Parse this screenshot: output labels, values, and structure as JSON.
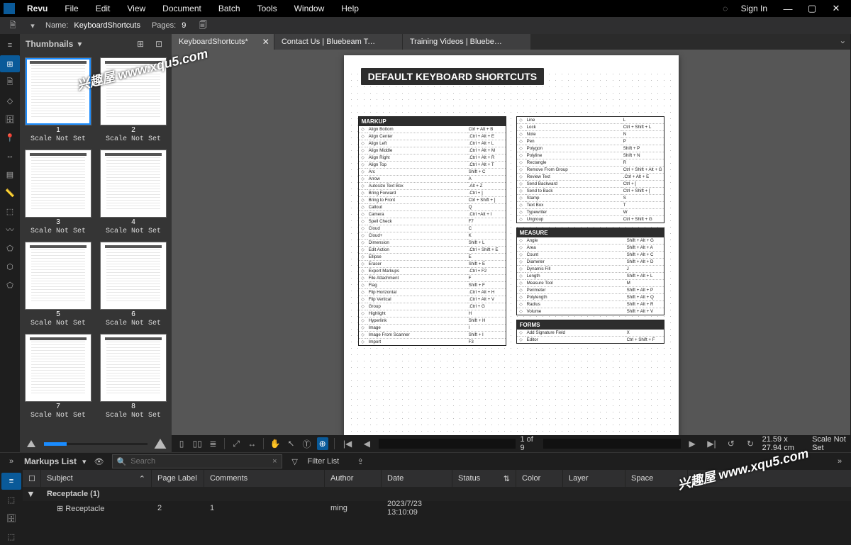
{
  "app": {
    "name": "Revu",
    "signin": "Sign In"
  },
  "menubar": [
    "File",
    "Edit",
    "View",
    "Document",
    "Batch",
    "Tools",
    "Window",
    "Help"
  ],
  "info": {
    "nameLabel": "Name:",
    "docName": "KeyboardShortcuts",
    "pagesLabel": "Pages:",
    "pagesVal": "9"
  },
  "thumbs": {
    "title": "Thumbnails",
    "items": [
      {
        "n": "1",
        "label": "Scale Not Set",
        "selected": true
      },
      {
        "n": "2",
        "label": "Scale Not Set"
      },
      {
        "n": "3",
        "label": "Scale Not Set"
      },
      {
        "n": "4",
        "label": "Scale Not Set"
      },
      {
        "n": "5",
        "label": "Scale Not Set"
      },
      {
        "n": "6",
        "label": "Scale Not Set"
      },
      {
        "n": "7",
        "label": "Scale Not Set"
      },
      {
        "n": "8",
        "label": "Scale Not Set"
      }
    ]
  },
  "tabs": [
    {
      "label": "KeyboardShortcuts*",
      "active": true,
      "closable": true
    },
    {
      "label": "Contact Us | Bluebeam Tec...",
      "active": false
    },
    {
      "label": "Training Videos | Bluebeam...",
      "active": false
    }
  ],
  "page": {
    "title": "DEFAULT KEYBOARD SHORTCUTS",
    "markup": [
      [
        "Align Bottom",
        "Ctrl + Alt + B"
      ],
      [
        "Align Center",
        ".Ctrl + Alt + E"
      ],
      [
        "Align Left",
        ".Ctrl + Alt + L"
      ],
      [
        "Align Middle",
        ".Ctrl + Alt + M"
      ],
      [
        "Align Right",
        ".Ctrl + Alt + R"
      ],
      [
        "Align Top",
        ".Ctrl + Alt + T"
      ],
      [
        "Arc",
        "Shift + C"
      ],
      [
        "Arrow",
        "A"
      ],
      [
        "Autosize Text Box",
        ".Alt + Z"
      ],
      [
        "Bring Forward",
        ".Ctrl + ]"
      ],
      [
        "Bring to Front",
        "Ctrl + Shift + ]"
      ],
      [
        "Callout",
        "Q"
      ],
      [
        "Camera",
        ".Ctrl +Alt + I"
      ],
      [
        "Spell Check",
        "F7"
      ],
      [
        "Cloud",
        "C"
      ],
      [
        "Cloud+",
        "K"
      ],
      [
        "Dimension",
        "Shift + L"
      ],
      [
        "Edit Action",
        ".Ctrl + Shift + E"
      ],
      [
        "Ellipse",
        "E"
      ],
      [
        "Eraser",
        "Shift + E"
      ],
      [
        "Export Markups",
        ".Ctrl + F2"
      ],
      [
        "File Attachment",
        "F"
      ],
      [
        "Flag",
        "Shift + F"
      ],
      [
        "Flip Horizontal",
        ".Ctrl + Alt + H"
      ],
      [
        "Flip Vertical",
        ".Ctrl + Alt + V"
      ],
      [
        "Group",
        ".Ctrl + G"
      ],
      [
        "Highlight",
        "H"
      ],
      [
        "Hyperlink",
        "Shift + H"
      ],
      [
        "Image",
        "I"
      ],
      [
        "Image From Scanner",
        "Shift + I"
      ],
      [
        "Import",
        "F3"
      ]
    ],
    "markup2": [
      [
        "Line",
        "L"
      ],
      [
        "Lock",
        "Ctrl + Shift + L"
      ],
      [
        "Note",
        "N"
      ],
      [
        "Pen",
        "P"
      ],
      [
        "Polygon",
        "Shift + P"
      ],
      [
        "Polyline",
        "Shift + N"
      ],
      [
        "Rectangle",
        "R"
      ],
      [
        "Remove From Group",
        "Ctrl + Shift + Alt + G"
      ],
      [
        "Review Text",
        ".Ctrl + Alt + E"
      ],
      [
        "Send Backward",
        "Ctrl + ["
      ],
      [
        "Send to Back",
        "Ctrl + Shift + ["
      ],
      [
        "Stamp",
        "S"
      ],
      [
        "Text Box",
        "T"
      ],
      [
        "Typewriter",
        "W"
      ],
      [
        "Ungroup",
        "Ctrl + Shift + G"
      ]
    ],
    "measure": [
      [
        "Angle",
        "Shift + Alt + G"
      ],
      [
        "Area",
        "Shift + Alt + A"
      ],
      [
        "Count",
        "Shift + Alt + C"
      ],
      [
        "Diameter",
        "Shift + Alt + D"
      ],
      [
        "Dynamic Fill",
        "J"
      ],
      [
        "Length",
        "Shift + Alt + L"
      ],
      [
        "Measure Tool",
        "M"
      ],
      [
        "Perimeter",
        "Shift + Alt + P"
      ],
      [
        "Polylength",
        "Shift + Alt + Q"
      ],
      [
        "Radius",
        "Shift + Alt + R"
      ],
      [
        "Volume",
        "Shift + Alt + V"
      ]
    ],
    "forms": [
      [
        "Add Signature Field",
        "X"
      ],
      [
        "Editor",
        "Ctrl + Shift + F"
      ]
    ],
    "sect": {
      "markup": "MARKUP",
      "measure": "MEASURE",
      "forms": "FORMS"
    }
  },
  "viewbar": {
    "pageIndicator": "1 of 9",
    "dims": "21.59 x 27.94 cm",
    "scale": "Scale Not Set"
  },
  "dock": {
    "title": "Markups List",
    "search": "Search",
    "filter": "Filter List",
    "columns": [
      "Subject",
      "Page Label",
      "Comments",
      "Author",
      "Date",
      "Status",
      "Color",
      "Layer",
      "Space"
    ],
    "group": {
      "name": "Receptacle",
      "count": "(1)"
    },
    "rows": [
      {
        "subject": "Receptacle",
        "page": "2",
        "comments": "1",
        "author": "ming",
        "date": "2023/7/23 13:10:09",
        "status": "",
        "color": "",
        "layer": "",
        "space": ""
      }
    ]
  },
  "watermark": "兴趣屋 www.xqu5.com"
}
